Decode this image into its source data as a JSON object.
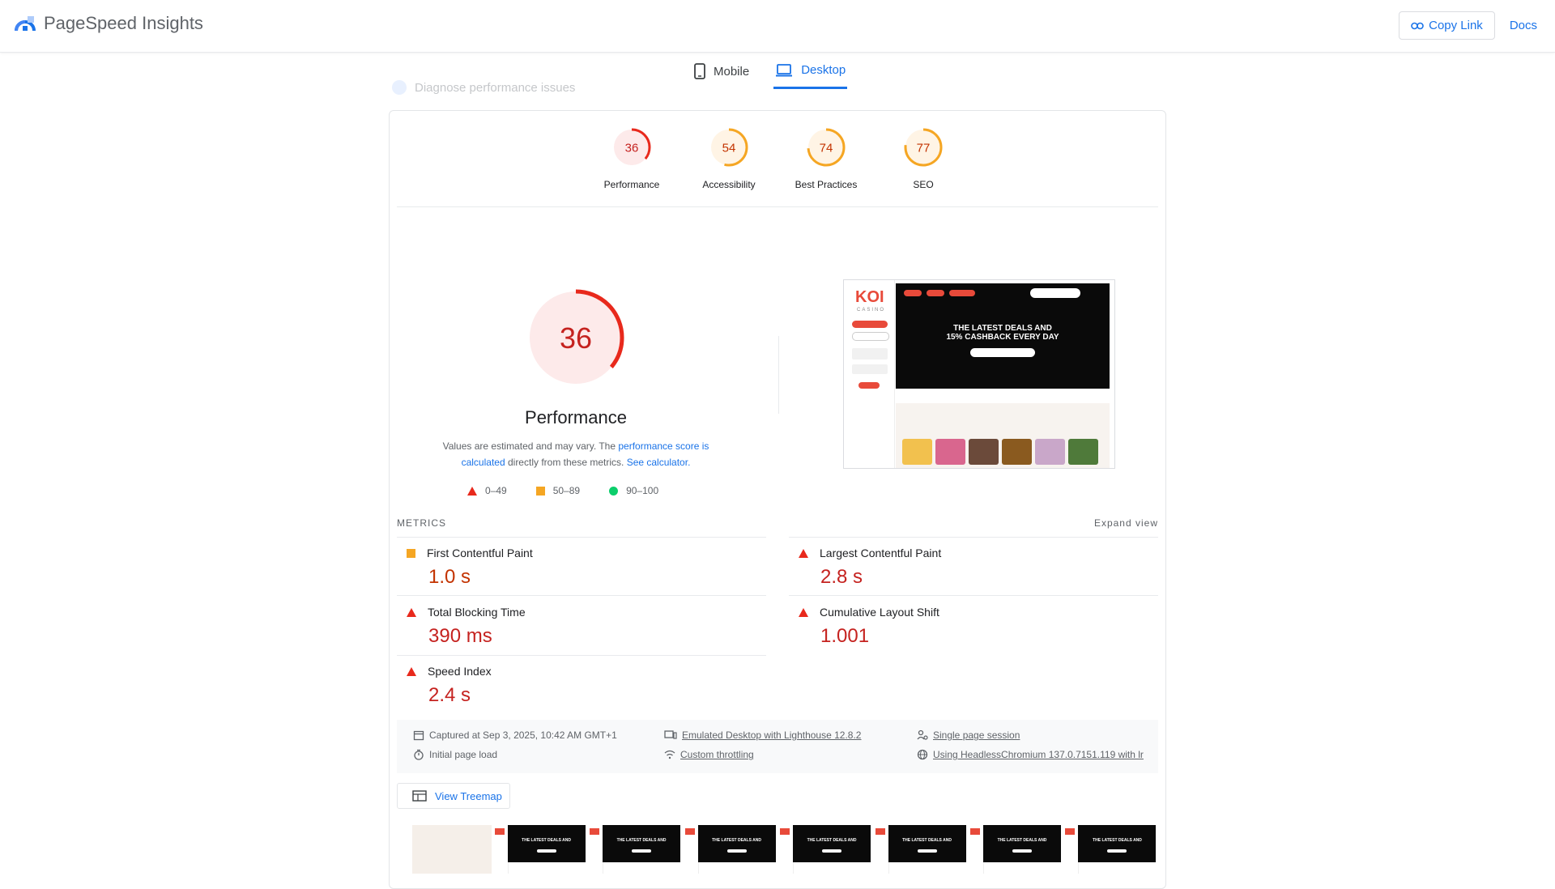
{
  "header": {
    "brand_title": "PageSpeed Insights",
    "copy_link_label": "Copy Link",
    "docs_label": "Docs"
  },
  "tabs": [
    {
      "label": "Mobile",
      "active": false
    },
    {
      "label": "Desktop",
      "active": true
    }
  ],
  "ghost_text": "Diagnose performance issues",
  "scores": [
    {
      "label": "Performance",
      "score": 36,
      "status": "fail"
    },
    {
      "label": "Accessibility",
      "score": 54,
      "status": "average"
    },
    {
      "label": "Best Practices",
      "score": 74,
      "status": "average"
    },
    {
      "label": "SEO",
      "score": 77,
      "status": "average"
    }
  ],
  "performance": {
    "score": 36,
    "title": "Performance",
    "note_prefix": "Values are estimated and may vary. The ",
    "note_link1": "performance score is calculated",
    "note_mid": " directly from these metrics. ",
    "note_link2": "See calculator."
  },
  "legend": [
    {
      "range": "0–49",
      "shape": "triangle"
    },
    {
      "range": "50–89",
      "shape": "square"
    },
    {
      "range": "90–100",
      "shape": "circle"
    }
  ],
  "thumbnail": {
    "logo": "KOI",
    "logo_sub": "CASINO",
    "headline_1": "THE LATEST DEALS AND",
    "headline_2": "15% CASHBACK EVERY DAY"
  },
  "metrics": {
    "heading": "METRICS",
    "expand_label": "Expand view",
    "items": [
      {
        "name": "First Contentful Paint",
        "value": "1.0 s",
        "status": "average"
      },
      {
        "name": "Largest Contentful Paint",
        "value": "2.8 s",
        "status": "fail"
      },
      {
        "name": "Total Blocking Time",
        "value": "390 ms",
        "status": "fail"
      },
      {
        "name": "Cumulative Layout Shift",
        "value": "1.001",
        "status": "fail"
      },
      {
        "name": "Speed Index",
        "value": "2.4 s",
        "status": "fail"
      }
    ]
  },
  "info": {
    "captured": "Captured at Sep 3, 2025, 10:42 AM GMT+1",
    "load": "Initial page load",
    "device": "Emulated Desktop with Lighthouse 12.8.2",
    "throttling": "Custom throttling",
    "session": "Single page session",
    "browser": "Using HeadlessChromium 137.0.7151.119 with lr"
  },
  "treemap_label": "View Treemap",
  "colors": {
    "fail": "#e8291c",
    "average": "#f5a623",
    "pass": "#0cce6b",
    "link": "#1a73e8",
    "value_red": "#c5221f"
  }
}
